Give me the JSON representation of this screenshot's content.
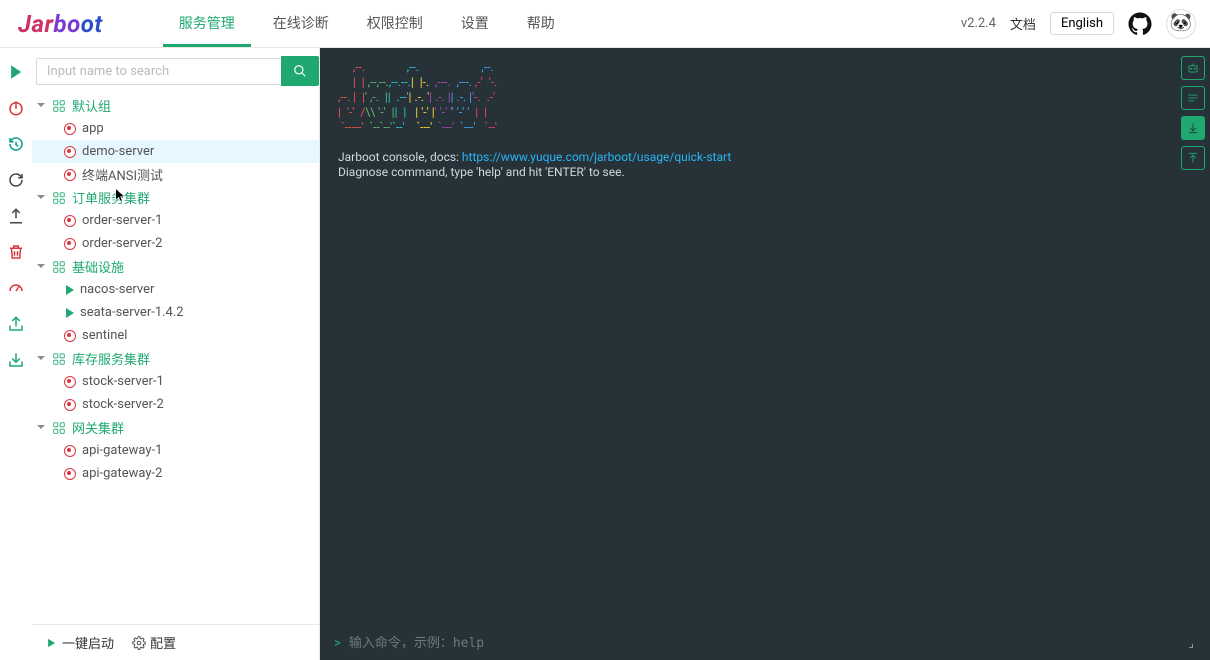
{
  "header": {
    "logo_text": "Jarboot",
    "nav": [
      {
        "label": "服务管理",
        "active": true
      },
      {
        "label": "在线诊断",
        "active": false
      },
      {
        "label": "权限控制",
        "active": false
      },
      {
        "label": "设置",
        "active": false
      },
      {
        "label": "帮助",
        "active": false
      }
    ],
    "version": "v2.2.4",
    "doc_label": "文档",
    "lang_label": "English"
  },
  "icon_bar": [
    {
      "name": "start-icon",
      "shape": "play",
      "color": "green"
    },
    {
      "name": "stop-icon",
      "shape": "power",
      "color": "red"
    },
    {
      "name": "restart-icon",
      "shape": "refresh-clock",
      "color": "teal"
    },
    {
      "name": "refresh-icon",
      "shape": "refresh",
      "color": "dark"
    },
    {
      "name": "upload-icon",
      "shape": "upload",
      "color": "dark"
    },
    {
      "name": "delete-icon",
      "shape": "trash",
      "color": "red"
    },
    {
      "name": "dashboard-icon",
      "shape": "gauge",
      "color": "red"
    },
    {
      "name": "export-icon",
      "shape": "share",
      "color": "green"
    },
    {
      "name": "import-icon",
      "shape": "import",
      "color": "green"
    }
  ],
  "search": {
    "placeholder": "Input name to search"
  },
  "tree": [
    {
      "type": "group",
      "label": "默认组",
      "children": [
        {
          "type": "leaf",
          "status": "stopped",
          "label": "app"
        },
        {
          "type": "leaf",
          "status": "stopped",
          "label": "demo-server",
          "selected": true
        },
        {
          "type": "leaf",
          "status": "stopped",
          "label": "终端ANSI测试"
        }
      ]
    },
    {
      "type": "group",
      "label": "订单服务集群",
      "children": [
        {
          "type": "leaf",
          "status": "stopped",
          "label": "order-server-1"
        },
        {
          "type": "leaf",
          "status": "stopped",
          "label": "order-server-2"
        }
      ]
    },
    {
      "type": "group",
      "label": "基础设施",
      "children": [
        {
          "type": "leaf",
          "status": "running",
          "label": "nacos-server"
        },
        {
          "type": "leaf",
          "status": "running",
          "label": "seata-server-1.4.2"
        },
        {
          "type": "leaf",
          "status": "stopped",
          "label": "sentinel"
        }
      ]
    },
    {
      "type": "group",
      "label": "库存服务集群",
      "children": [
        {
          "type": "leaf",
          "status": "stopped",
          "label": "stock-server-1"
        },
        {
          "type": "leaf",
          "status": "stopped",
          "label": "stock-server-2"
        }
      ]
    },
    {
      "type": "group",
      "label": "网关集群",
      "children": [
        {
          "type": "leaf",
          "status": "stopped",
          "label": "api-gateway-1"
        },
        {
          "type": "leaf",
          "status": "stopped",
          "label": "api-gateway-2"
        }
      ]
    }
  ],
  "bottom_bar": {
    "start_all": "一键启动",
    "config": "配置"
  },
  "terminal": {
    "line1": "Jarboot console, docs: ",
    "link": "https://www.yuque.com/jarboot/usage/quick-start",
    "line2": "Diagnose command, type 'help' and hit 'ENTER' to see.",
    "input_placeholder": "输入命令，示例：help"
  },
  "term_tools": [
    {
      "name": "robot-icon",
      "filled": false
    },
    {
      "name": "wrap-icon",
      "filled": false
    },
    {
      "name": "scroll-bottom-icon",
      "filled": true
    },
    {
      "name": "scroll-top-icon",
      "filled": false
    }
  ]
}
